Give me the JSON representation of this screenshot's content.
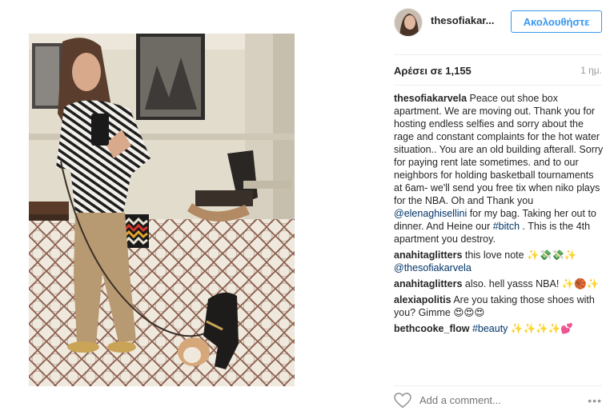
{
  "post": {
    "username": "thesofiakar...",
    "follow_label": "Ακολουθήστε",
    "likes_text": "Αρέσει σε 1,155",
    "time_text": "1 ημ."
  },
  "caption": {
    "user": "thesofiakarvela",
    "text_part1": " Peace out shoe box apartment. We are moving out. Thank you for hosting endless selfies and sorry about the rage and constant complaints for the hot water situation.. You are an old building afterall. Sorry for paying rent late sometimes. and to our neighbors for holding basketball tournaments at 6am- we'll send you free tix when niko plays for the NBA. Oh and Thank you ",
    "mention": "@elenaghisellini",
    "text_part2": " for my bag. Taking her out to dinner. And Heine our ",
    "hashtag": "#bitch",
    "text_part3": " . This is the 4th apartment you destroy."
  },
  "comments": [
    {
      "user": "anahitaglitters",
      "text": " this love note ✨💸💸✨",
      "mention": "@thesofiakarvela"
    },
    {
      "user": "anahitaglitters",
      "text": " also. hell yasss NBA! ✨🏀✨"
    },
    {
      "user": "alexiapolitis",
      "text": " Are you taking those shoes with you? Gimme 😍😍😍"
    },
    {
      "user": "bethcooke_flow",
      "hashtag": " #beauty",
      "text": " ✨✨✨✨💕"
    }
  ],
  "footer": {
    "add_comment_placeholder": "Add a comment...",
    "more_label": "•••"
  },
  "icons": {
    "heart": "heart-icon",
    "more": "more-options-icon"
  },
  "colors": {
    "accent": "#3897f0",
    "link": "#003569",
    "muted": "#999999"
  }
}
